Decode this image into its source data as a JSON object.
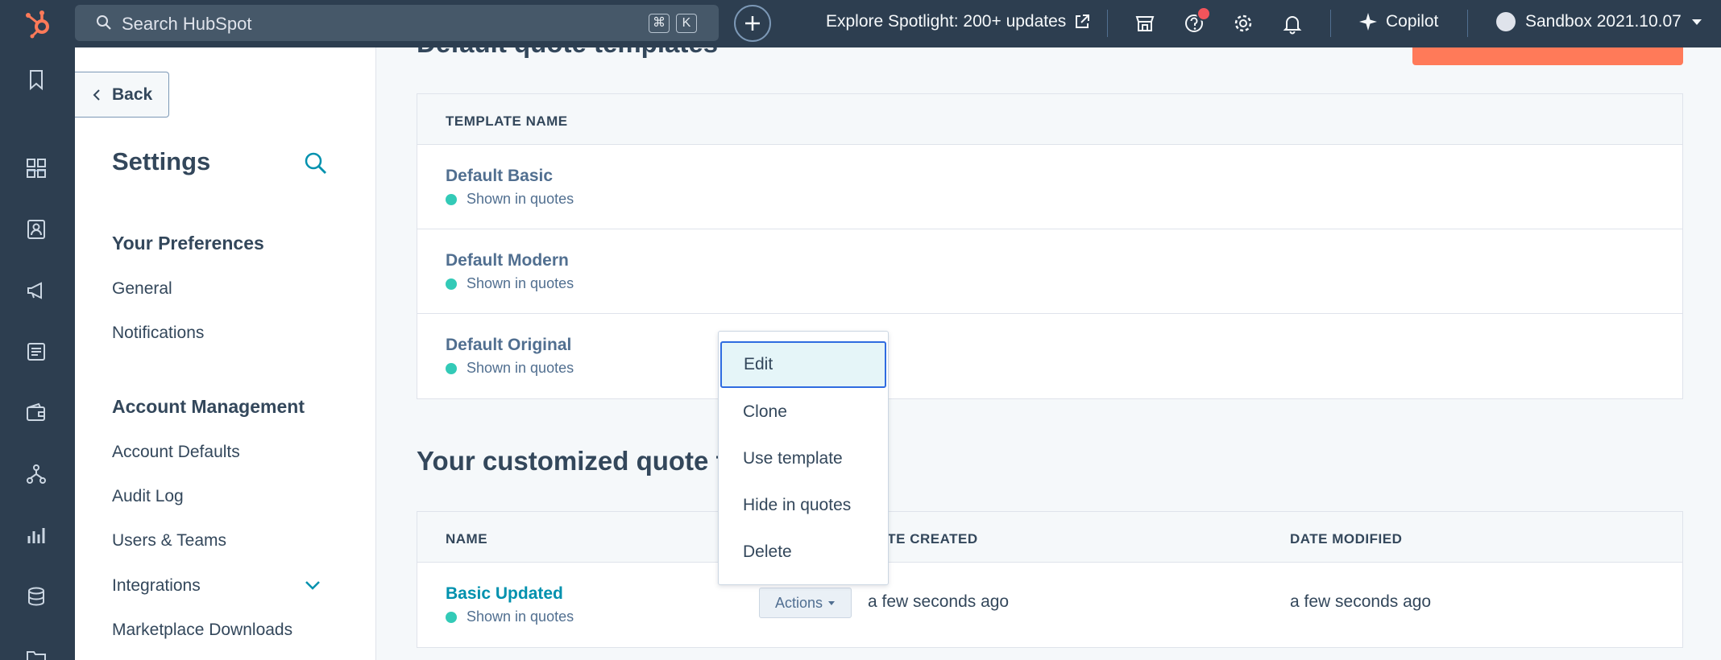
{
  "topbar": {
    "search_placeholder": "Search HubSpot",
    "shortcut_keys": [
      "⌘",
      "K"
    ],
    "spotlight_label": "Explore Spotlight: 200+ updates",
    "copilot_label": "Copilot",
    "account_label": "Sandbox 2021.10.07",
    "colors": {
      "bar": "#2d3e50",
      "brand": "#ff7a59",
      "badge": "#f2545b"
    }
  },
  "rail": {
    "icons": [
      "bookmark-icon",
      "grid-icon",
      "contacts-icon",
      "megaphone-icon",
      "content-icon",
      "wallet-icon",
      "workflow-icon",
      "chart-icon",
      "database-icon",
      "folder-icon"
    ]
  },
  "sidebar": {
    "back_label": "Back",
    "title": "Settings",
    "preferences_heading": "Your Preferences",
    "preferences_items": [
      "General",
      "Notifications"
    ],
    "account_heading": "Account Management",
    "account_items": [
      "Account Defaults",
      "Audit Log",
      "Users & Teams",
      "Integrations",
      "Marketplace Downloads"
    ]
  },
  "main": {
    "default_title": "Default quote templates",
    "default_table": {
      "header": "TEMPLATE NAME",
      "rows": [
        {
          "name": "Default Basic",
          "status": "Shown in quotes"
        },
        {
          "name": "Default Modern",
          "status": "Shown in quotes"
        },
        {
          "name": "Default Original",
          "status": "Shown in quotes"
        }
      ]
    },
    "custom_title": "Your customized quote templates",
    "custom_table": {
      "headers": [
        "NAME",
        "DATE CREATED",
        "DATE MODIFIED"
      ],
      "rows": [
        {
          "name": "Basic Updated",
          "status": "Shown in quotes",
          "actions_label": "Actions",
          "created": "a few seconds ago",
          "modified": "a few seconds ago"
        }
      ]
    }
  },
  "dropdown": {
    "items": [
      "Edit",
      "Clone",
      "Use template",
      "Hide in quotes",
      "Delete"
    ],
    "focused_index": 0,
    "focus_color": "#2f6be0"
  }
}
